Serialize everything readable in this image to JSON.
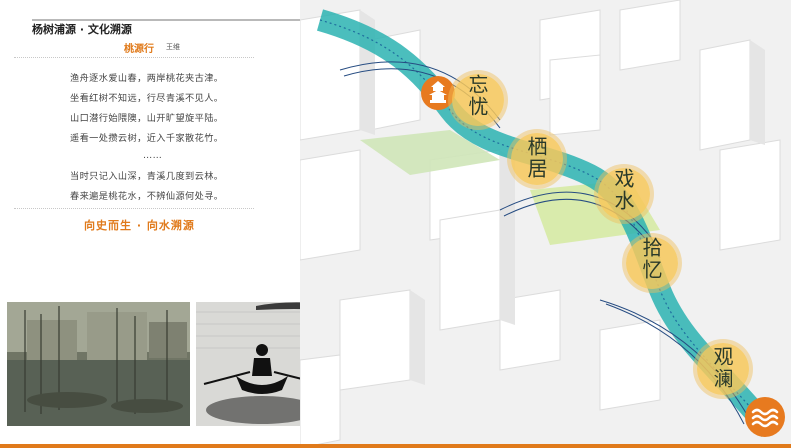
{
  "header": {
    "title": "杨树浦源 · 文化溯源"
  },
  "poem": {
    "title": "桃源行",
    "author": "王维",
    "lines": [
      "渔舟逐水爱山春，两岸桃花夹古津。",
      "坐看红树不知远，行尽青溪不见人。",
      "山口潜行始隈隩，山开旷望旋平陆。",
      "遥看一处攒云树，近入千家散花竹。",
      "……",
      "当时只记入山深，青溪几度到云林。",
      "春来遍是桃花水，不辨仙源何处寻。"
    ]
  },
  "motto": "向史而生 · 向水溯源",
  "stations": [
    {
      "label": "忘忧"
    },
    {
      "label": "栖居"
    },
    {
      "label": "戏水"
    },
    {
      "label": "拾忆"
    },
    {
      "label": "观澜"
    }
  ],
  "colors": {
    "accent": "#e07a1b",
    "badge": "#f5c35a",
    "river": "#2bb3b1"
  },
  "icons": {
    "logo_top": "pagoda-icon",
    "logo_bottom": "wave-icon"
  }
}
